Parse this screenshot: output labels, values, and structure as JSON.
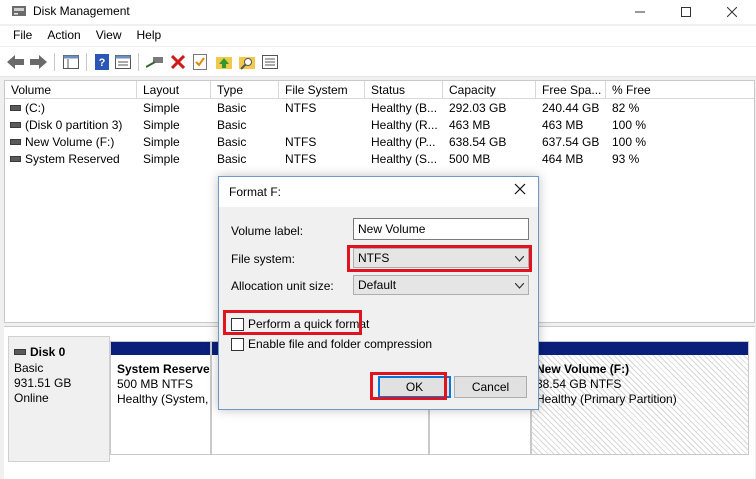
{
  "window": {
    "title": "Disk Management"
  },
  "menu": [
    "File",
    "Action",
    "View",
    "Help"
  ],
  "toolbar": {
    "icons": [
      "back-arrow-icon",
      "forward-arrow-icon",
      "console-tree-icon",
      "help-icon",
      "properties-icon",
      "connect-icon",
      "delete-icon",
      "checklist-icon",
      "folder-up-icon",
      "search-folder-icon",
      "list-view-icon"
    ]
  },
  "volume_list": {
    "columns": [
      "Volume",
      "Layout",
      "Type",
      "File System",
      "Status",
      "Capacity",
      "Free Spa...",
      "% Free"
    ],
    "rows": [
      {
        "volume": "(C:)",
        "layout": "Simple",
        "type": "Basic",
        "fs": "NTFS",
        "status": "Healthy (B...",
        "capacity": "292.03 GB",
        "free": "240.44 GB",
        "pct": "82 %"
      },
      {
        "volume": "(Disk 0 partition 3)",
        "layout": "Simple",
        "type": "Basic",
        "fs": "",
        "status": "Healthy (R...",
        "capacity": "463 MB",
        "free": "463 MB",
        "pct": "100 %"
      },
      {
        "volume": "New Volume (F:)",
        "layout": "Simple",
        "type": "Basic",
        "fs": "NTFS",
        "status": "Healthy (P...",
        "capacity": "638.54 GB",
        "free": "637.54 GB",
        "pct": "100 %"
      },
      {
        "volume": "System Reserved",
        "layout": "Simple",
        "type": "Basic",
        "fs": "NTFS",
        "status": "Healthy (S...",
        "capacity": "500 MB",
        "free": "464 MB",
        "pct": "93 %"
      }
    ]
  },
  "disk": {
    "name": "Disk 0",
    "type": "Basic",
    "size": "931.51 GB",
    "state": "Online",
    "partitions": [
      {
        "name": "System Reserve",
        "size": "500 MB NTFS",
        "status": "Healthy (System,"
      },
      {
        "name": "New Volume  (F:)",
        "size": "38.54 GB NTFS",
        "status": "Healthy (Primary Partition)"
      }
    ]
  },
  "dialog": {
    "title": "Format F:",
    "volume_label_label": "Volume label:",
    "volume_label_value": "New Volume",
    "file_system_label": "File system:",
    "file_system_value": "NTFS",
    "alloc_label": "Allocation unit size:",
    "alloc_value": "Default",
    "quick_format_label": "Perform a quick format",
    "quick_format_checked": false,
    "compression_label": "Enable file and folder compression",
    "compression_checked": false,
    "ok_label": "OK",
    "cancel_label": "Cancel"
  },
  "colors": {
    "highlight": "#e0141e",
    "partition_bar": "#0a1f7a"
  }
}
